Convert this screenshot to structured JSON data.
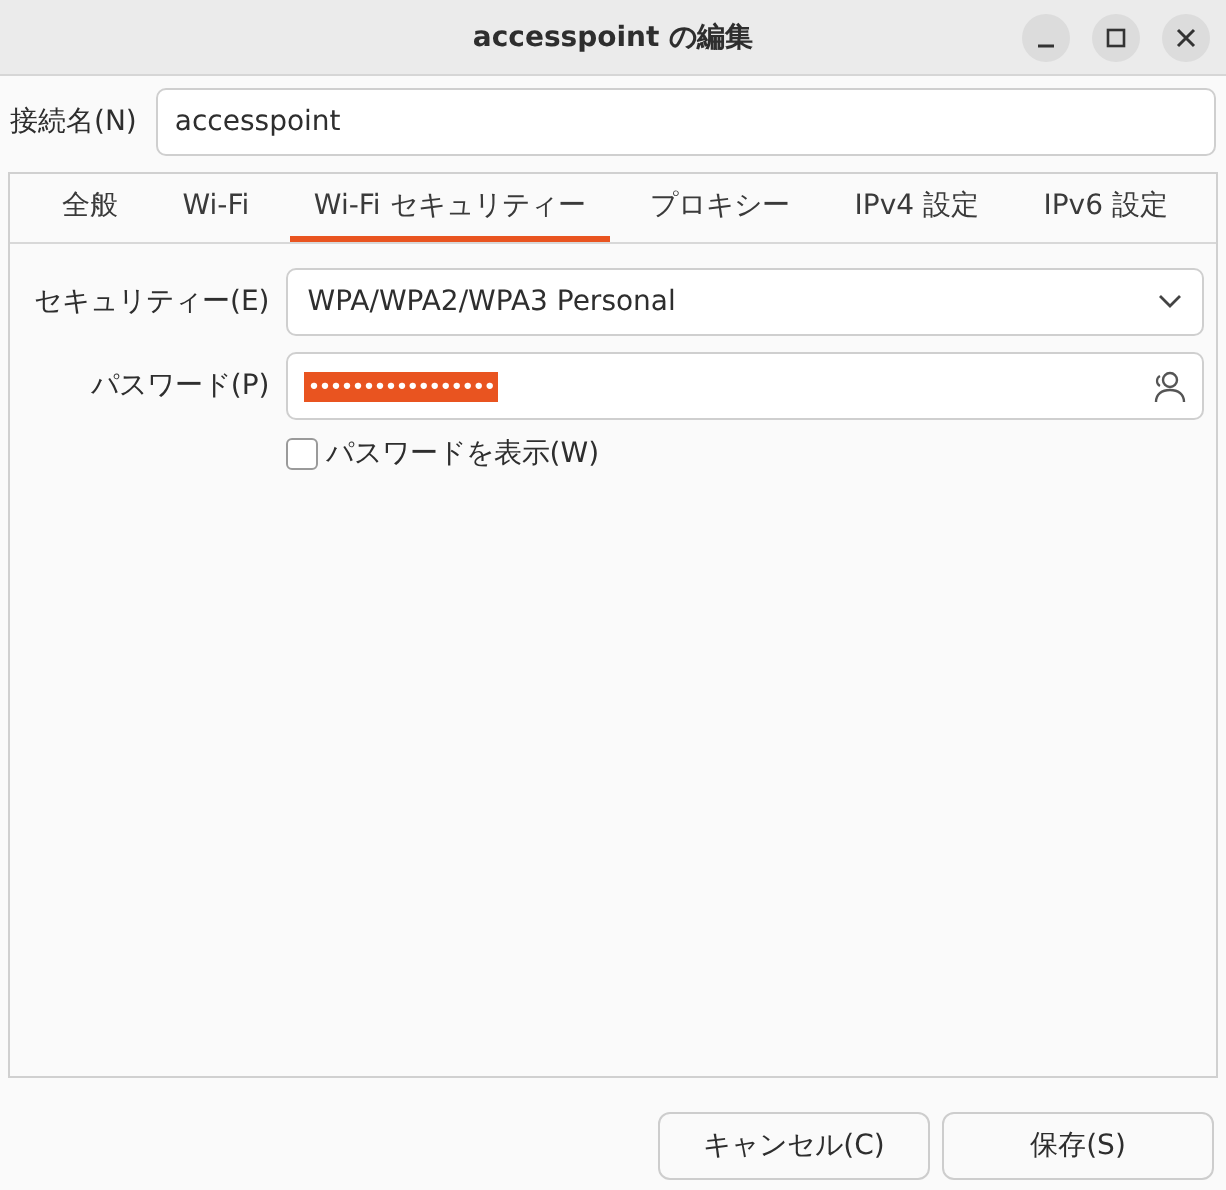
{
  "window": {
    "title": "accesspoint の編集"
  },
  "connection_name": {
    "label": "接続名(N)",
    "value": "accesspoint"
  },
  "tabs": [
    {
      "label": "全般",
      "selected": false
    },
    {
      "label": "Wi-Fi",
      "selected": false
    },
    {
      "label": "Wi-Fi セキュリティー",
      "selected": true
    },
    {
      "label": "プロキシー",
      "selected": false
    },
    {
      "label": "IPv4 設定",
      "selected": false
    },
    {
      "label": "IPv6 設定",
      "selected": false
    }
  ],
  "security": {
    "label": "セキュリティー(E)",
    "value": "WPA/WPA2/WPA3 Personal"
  },
  "password": {
    "label": "パスワード(P)",
    "value": "•••••••••••••••••",
    "selected": true
  },
  "show_password": {
    "label": "パスワードを表示(W)",
    "checked": false
  },
  "buttons": [
    "キャンセル(C)",
    "保存(S)"
  ]
}
